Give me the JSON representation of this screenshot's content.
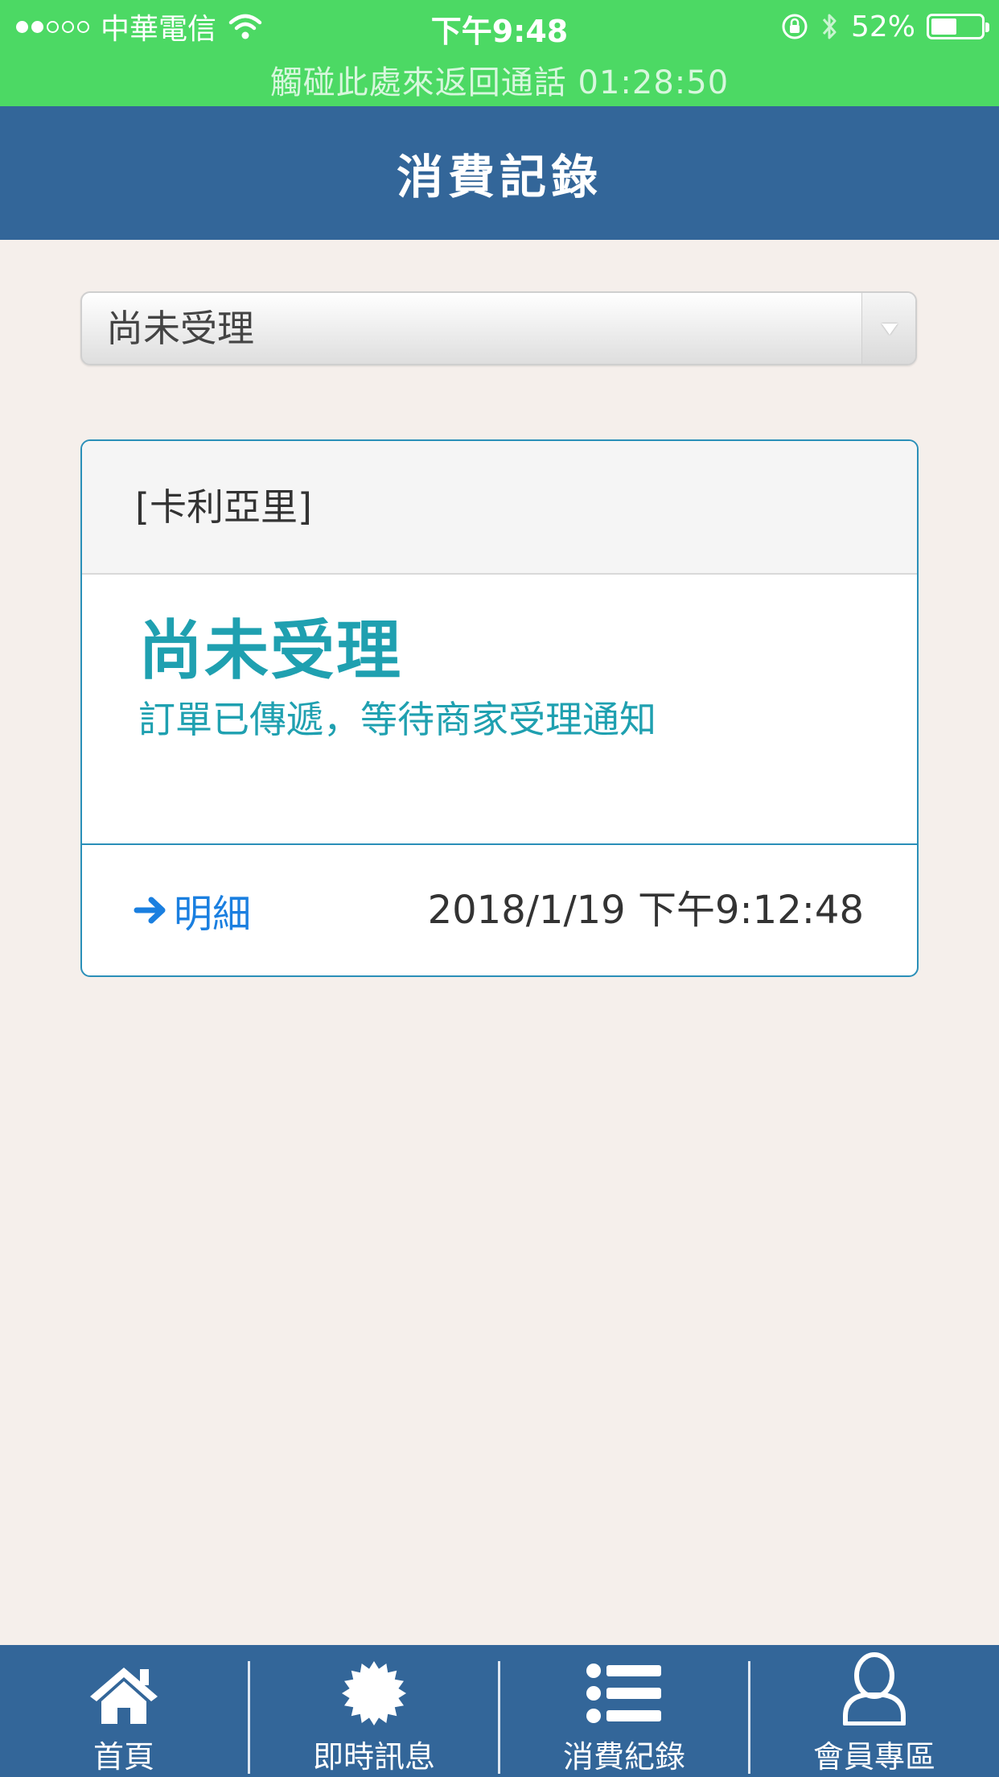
{
  "status_bar": {
    "carrier": "中華電信",
    "time": "下午9:48",
    "battery": "52%",
    "battery_level": 0.52,
    "call_banner": "觸碰此處來返回通話 01:28:50"
  },
  "header": {
    "title": "消費記錄"
  },
  "filter": {
    "selected": "尚未受理"
  },
  "order_card": {
    "shop": "[卡利亞里]",
    "status": "尚未受理",
    "message": "訂單已傳遞，等待商家受理通知",
    "detail_label": "明細",
    "datetime": "2018/1/19 下午9:12:48"
  },
  "tab_bar": {
    "tabs": [
      {
        "label": "首頁",
        "icon": "home-icon"
      },
      {
        "label": "即時訊息",
        "icon": "starburst-icon"
      },
      {
        "label": "消費紀錄",
        "icon": "list-icon"
      },
      {
        "label": "會員專區",
        "icon": "user-icon"
      }
    ]
  },
  "colors": {
    "status_green": "#4cd964",
    "header_blue": "#336699",
    "accent_teal": "#1fa0b0",
    "link_blue": "#1a7fe0",
    "page_bg": "#f5efeb"
  }
}
